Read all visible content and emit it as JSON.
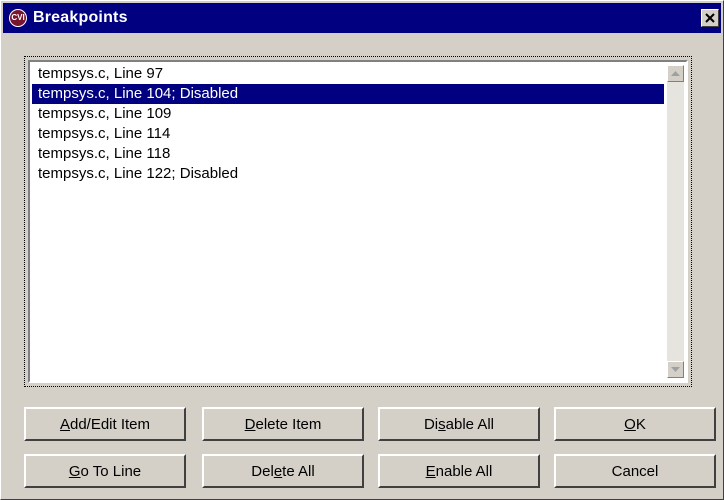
{
  "window": {
    "title": "Breakpoints",
    "icon": "cvi-app-icon",
    "icon_text": "CVI",
    "close_glyph": "x-icon"
  },
  "breakpoints": {
    "items": [
      {
        "text": "tempsys.c, Line 97",
        "selected": false
      },
      {
        "text": "tempsys.c, Line 104;  Disabled",
        "selected": true
      },
      {
        "text": "tempsys.c, Line 109",
        "selected": false
      },
      {
        "text": "tempsys.c, Line 114",
        "selected": false
      },
      {
        "text": "tempsys.c, Line 118",
        "selected": false
      },
      {
        "text": "tempsys.c, Line 122;  Disabled",
        "selected": false
      }
    ]
  },
  "buttons": {
    "add_edit": {
      "pre": "",
      "acc": "A",
      "post": "dd/Edit Item"
    },
    "delete_item": {
      "pre": "",
      "acc": "D",
      "post": "elete Item"
    },
    "disable_all": {
      "pre": "Di",
      "acc": "s",
      "post": "able All"
    },
    "ok": {
      "pre": "",
      "acc": "O",
      "post": "K"
    },
    "go_to_line": {
      "pre": "",
      "acc": "G",
      "post": "o To Line"
    },
    "delete_all": {
      "pre": "Del",
      "acc": "e",
      "post": "te All"
    },
    "enable_all": {
      "pre": "",
      "acc": "E",
      "post": "nable All"
    },
    "cancel": {
      "pre": "Cancel",
      "acc": "",
      "post": ""
    }
  },
  "colors": {
    "titlebar": "#000080",
    "selection": "#000080",
    "face": "#d4d0c8"
  }
}
